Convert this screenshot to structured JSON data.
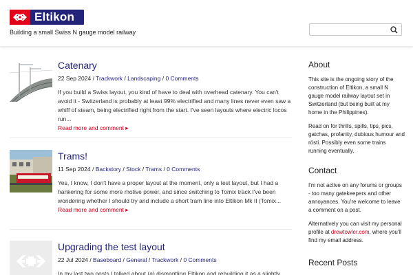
{
  "site": {
    "brand": "Eltikon",
    "tagline": "Building a small Swiss N gauge model railway",
    "brand_color": "#23237a",
    "logo_red": "#e3001b",
    "accent": "#c8001a"
  },
  "search": {
    "placeholder": "",
    "icon": "search-icon"
  },
  "posts": [
    {
      "title": "Catenary",
      "date": "22 Sep 2024",
      "categories": [
        "Trackwork",
        "Landscaping"
      ],
      "comments": "0 Comments",
      "excerpt": "If you build a Swiss layout, you kind of have to deal with overhead catenary. You can't avoid it - Switzerland is probably at least 99% electrified and many lines never even saw a whiff of steam, being electrified right from the start. I've seen layouts where electric locos run...",
      "read_more": "Read more and comment",
      "thumbnail": "catenary-photo"
    },
    {
      "title": "Trams!",
      "date": "11 Sep 2024",
      "categories": [
        "Backstory",
        "Stock",
        "Trams"
      ],
      "comments": "0 Comments",
      "excerpt": "Yes, I know, I don't have a proper layout at the moment, only a test layout, but I had a hankering for some more motive power, and since switching to Tomix track I've been wondering whether I should try and include a short tram line into Eltikon Mk II (Tomix...",
      "read_more": "Read more and comment",
      "thumbnail": "tram-photo"
    },
    {
      "title": "Upgrading the test layout",
      "date": "22 Jul 2024",
      "categories": [
        "Baseboard",
        "General",
        "Trackwork"
      ],
      "comments": "0 Comments",
      "excerpt": "In my last two posts I talked about (a) dismantling Eltikon and rebuilding it as a slightly larger",
      "read_more": "",
      "thumbnail": "placeholder-logo"
    }
  ],
  "sidebar": {
    "about": {
      "heading": "About",
      "p1": "This site is the ongoing story of the construction of Eltikon, a small N gauge model railway layout set in Switzerland (but being built at my home in the Philippines).",
      "p2": "Read on for thrills, spills, tips, pics, gatchas, profanity, dubious humour and rösti. Possibly even some trains running eventually."
    },
    "contact": {
      "heading": "Contact",
      "p1": "I'm not active on any forums or groups - too many gatekeepers and other annoyances. You're welcome to leave a comment on a post.",
      "p2_before": "Alternatively you can visit my personal profile at ",
      "p2_link": "drewtowler.com",
      "p2_after": ", where you'll find my email address."
    },
    "recent": {
      "heading": "Recent Posts"
    }
  }
}
